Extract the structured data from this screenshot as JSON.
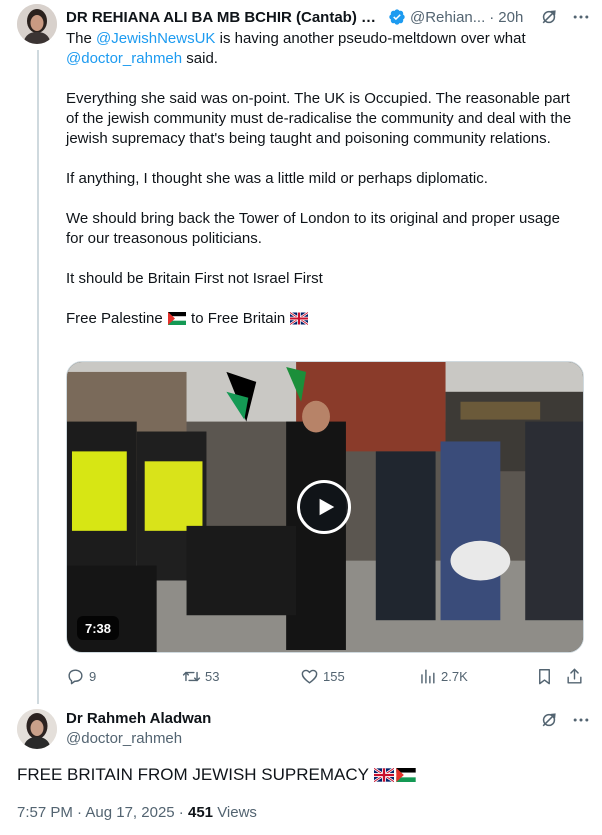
{
  "colors": {
    "link": "#1d9bf0",
    "secondary_text": "#536471",
    "primary_text": "#0f1419",
    "thread_line": "#cfd9de"
  },
  "parent_tweet": {
    "author_name": "DR REHIANA ALI BA MB BCHIR (Cantab) M...",
    "verified": true,
    "handle": "@Rehian...",
    "separator": "·",
    "age": "20h",
    "header_icons": [
      "grok-icon",
      "more-icon"
    ],
    "para1": {
      "t1": "The ",
      "m1": "@JewishNewsUK",
      "t2": " is having another pseudo-meltdown over what ",
      "m2": "@doctor_rahmeh",
      "t3": " said."
    },
    "para2": "Everything she said was on-point. The UK is Occupied. The reasonable part of the jewish community must de-radicalise the community and deal with the jewish supremacy that's being taught and poisoning community relations.",
    "para3": "If anything, I thought she was a little mild or perhaps diplomatic.",
    "para4": "We should bring back the Tower of London to its original and proper usage for our treasonous politicians.",
    "para5": "It should be Britain First not Israel First",
    "para6": {
      "t1": "Free Palestine ",
      "flag1": "palestine-flag",
      "t2": " to Free Britain ",
      "flag2": "uk-flag"
    },
    "video": {
      "duration": "7:38",
      "icon": "play-icon"
    },
    "actions": {
      "replies": "9",
      "reposts": "53",
      "likes": "155",
      "views": "2.7K"
    }
  },
  "reply_tweet": {
    "author_name": "Dr Rahmeh Aladwan",
    "handle": "@doctor_rahmeh",
    "header_icons": [
      "grok-icon",
      "more-icon"
    ],
    "text": "FREE BRITAIN FROM JEWISH SUPREMACY",
    "flags": [
      "uk-flag",
      "palestine-flag"
    ],
    "time": "7:57 PM",
    "date_sep": " · ",
    "date": "Aug 17, 2025",
    "views_count": "451",
    "views_label": "Views"
  }
}
